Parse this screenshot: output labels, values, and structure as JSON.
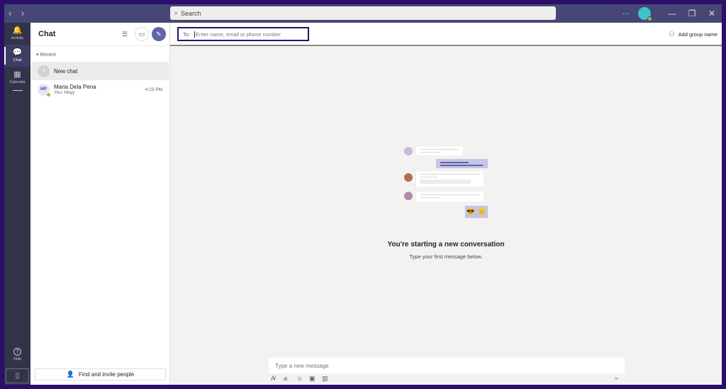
{
  "titlebar": {
    "back_icon": "‹",
    "forward_icon": "›",
    "search_placeholder": "Search",
    "more_label": "···",
    "minimize": "—",
    "maximize": "❐",
    "close": "✕"
  },
  "rail": {
    "items": [
      {
        "label": "Activity",
        "icon": "bell-icon",
        "glyph": "🔔",
        "active": false
      },
      {
        "label": "Chat",
        "icon": "chat-icon",
        "glyph": "💬",
        "active": true
      },
      {
        "label": "Calendar",
        "icon": "calendar-icon",
        "glyph": "▦",
        "active": false
      }
    ],
    "help_label": "Help",
    "help_glyph": "?",
    "phone_glyph": "▯"
  },
  "chat_list": {
    "title": "Chat",
    "filter_glyph": "☰",
    "video_glyph": "▭",
    "compose_glyph": "✎",
    "section_label": "Recent",
    "items": [
      {
        "name": "New chat",
        "preview": "",
        "time": "",
        "initials": "",
        "selected": true
      },
      {
        "name": "Maria Dela Pena",
        "preview": "You: Heyy",
        "time": "4:23 PM",
        "initials": "MP",
        "selected": false
      }
    ],
    "find_people_label": "Find and invite people"
  },
  "main": {
    "to_label": "To:",
    "to_placeholder": "Enter name, email or phone number",
    "add_group_label": "Add group name",
    "empty_title": "You're starting a new conversation",
    "empty_subtitle": "Type your first message below.",
    "compose_placeholder": "Type a new message",
    "compose_tools": [
      "format-icon",
      "attach-icon",
      "emoji-icon",
      "gif-icon",
      "poll-icon"
    ],
    "send_glyph": "➢"
  },
  "colors": {
    "brand": "#6264a7",
    "titlebar": "#464775",
    "rail": "#33344a",
    "frame": "#2b0f6b",
    "presence": "#92c353"
  }
}
